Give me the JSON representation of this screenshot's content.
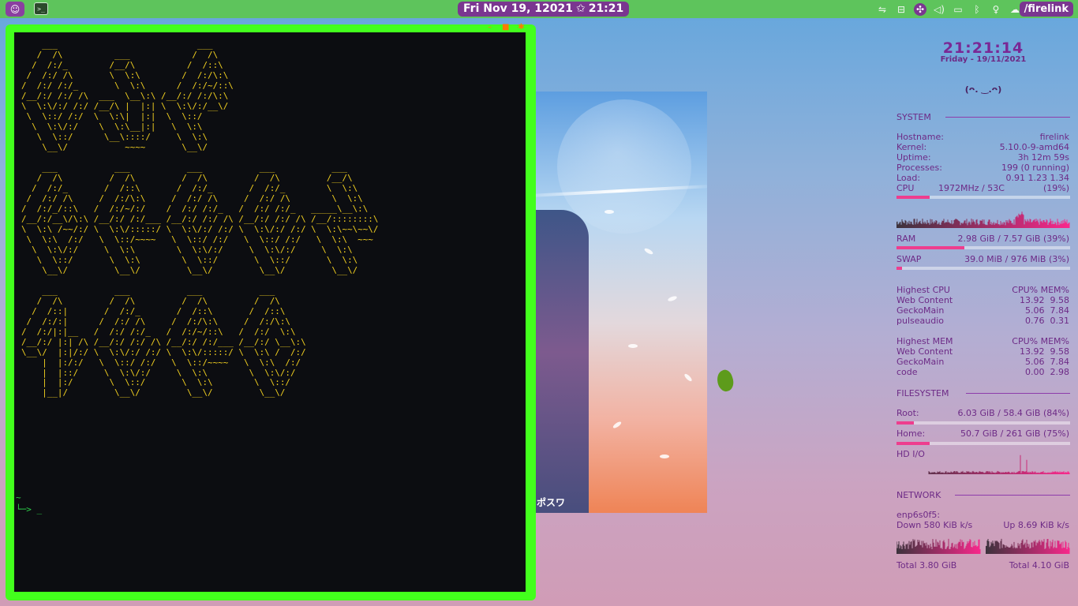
{
  "topbar": {
    "launcher_icon": "whisker-menu-icon",
    "terminal_icon": "terminal-icon",
    "clock_date": "Fri Nov 19, 12021",
    "clock_star": "✩",
    "clock_time": "21:21",
    "tray_icons": [
      "usb-icon",
      "car-icon",
      "dropbox-icon",
      "volume-icon",
      "display-icon",
      "bluetooth-icon",
      "lightbulb-icon",
      "cloud-icon"
    ],
    "path_label": "/firelink"
  },
  "terminal": {
    "window_buttons": [
      "minimize-button",
      "maximize-button",
      "close-button"
    ],
    "prompt_line1": "~",
    "prompt_line2": "└─> _"
  },
  "wallpaper": {
    "poster_text": "ポスワ"
  },
  "conky": {
    "time": "21:21:14",
    "date": "Friday - 19/11/2021",
    "face": "(ᴖ. ‿.ᴖ)",
    "system": {
      "title": "SYSTEM",
      "hostname_label": "Hostname:",
      "hostname": "firelink",
      "kernel_label": "Kernel:",
      "kernel": "5.10.0-9-amd64",
      "uptime_label": "Uptime:",
      "uptime": "3h 12m 59s",
      "processes_label": "Processes:",
      "processes": "199 (0 running)",
      "load_label": "Load:",
      "load": "0.91 1.23 1.34",
      "cpu_label": "CPU",
      "cpu_freq": "1972MHz / 53C",
      "cpu_pct": "(19%)",
      "cpu_fraction": 0.19,
      "ram_label": "RAM",
      "ram": "2.98 GiB / 7.57 GiB (39%)",
      "ram_fraction": 0.39,
      "swap_label": "SWAP",
      "swap": "39.0 MiB / 976 MiB (3%)",
      "swap_fraction": 0.03
    },
    "highest_cpu": {
      "title": "Highest CPU",
      "cols": "CPU% MEM%",
      "rows": [
        {
          "name": "Web Content",
          "vals": "13.92  9.58"
        },
        {
          "name": "GeckoMain",
          "vals": "5.06  7.84"
        },
        {
          "name": "pulseaudio",
          "vals": "0.76  0.31"
        }
      ]
    },
    "highest_mem": {
      "title": "Highest MEM",
      "cols": "CPU% MEM%",
      "rows": [
        {
          "name": "Web Content",
          "vals": "13.92  9.58"
        },
        {
          "name": "GeckoMain",
          "vals": "5.06  7.84"
        },
        {
          "name": "code",
          "vals": "0.00  2.98"
        }
      ]
    },
    "filesystem": {
      "title": "FILESYSTEM",
      "root_label": "Root:",
      "root": "6.03 GiB / 58.4 GiB (84%)",
      "root_fraction": 0.1,
      "home_label": "Home:",
      "home": "50.7 GiB / 261 GiB (75%)",
      "home_fraction": 0.19,
      "hdio_label": "HD I/O"
    },
    "network": {
      "title": "NETWORK",
      "iface": "enp6s0f5:",
      "down": "Down 580 KiB k/s",
      "up": "Up 8.69 KiB k/s",
      "total_down": "Total 3.80 GiB",
      "total_up": "Total 4.10 GiB"
    }
  }
}
